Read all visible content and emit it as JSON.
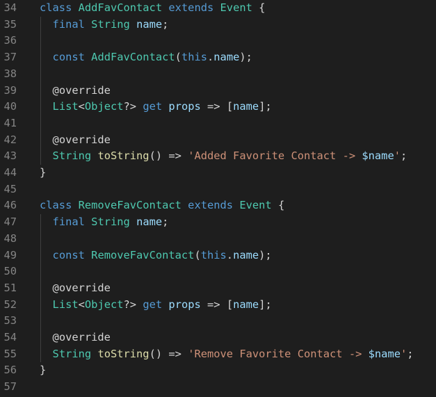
{
  "editor": {
    "colors": {
      "background": "#1e1e1e",
      "line_number": "#858585",
      "keyword": "#569cd6",
      "type": "#4ec9b0",
      "identifier": "#9cdcfe",
      "function": "#dcdcaa",
      "string": "#ce9178",
      "punctuation": "#d4d4d4"
    },
    "lines": [
      {
        "num": "34",
        "tokens": [
          {
            "t": "class",
            "c": "kw"
          },
          {
            "t": " ",
            "c": "pu"
          },
          {
            "t": "AddFavContact",
            "c": "ty"
          },
          {
            "t": " ",
            "c": "pu"
          },
          {
            "t": "extends",
            "c": "kw"
          },
          {
            "t": " ",
            "c": "pu"
          },
          {
            "t": "Event",
            "c": "ty"
          },
          {
            "t": " {",
            "c": "pu"
          }
        ]
      },
      {
        "num": "35",
        "tokens": [
          {
            "t": "  ",
            "c": "pu"
          },
          {
            "t": "final",
            "c": "kw"
          },
          {
            "t": " ",
            "c": "pu"
          },
          {
            "t": "String",
            "c": "ty"
          },
          {
            "t": " ",
            "c": "pu"
          },
          {
            "t": "name",
            "c": "id"
          },
          {
            "t": ";",
            "c": "pu"
          }
        ]
      },
      {
        "num": "36",
        "tokens": []
      },
      {
        "num": "37",
        "tokens": [
          {
            "t": "  ",
            "c": "pu"
          },
          {
            "t": "const",
            "c": "kw"
          },
          {
            "t": " ",
            "c": "pu"
          },
          {
            "t": "AddFavContact",
            "c": "ty"
          },
          {
            "t": "(",
            "c": "pu"
          },
          {
            "t": "this",
            "c": "kw"
          },
          {
            "t": ".",
            "c": "pu"
          },
          {
            "t": "name",
            "c": "id"
          },
          {
            "t": ");",
            "c": "pu"
          }
        ]
      },
      {
        "num": "38",
        "tokens": []
      },
      {
        "num": "39",
        "tokens": [
          {
            "t": "  ",
            "c": "pu"
          },
          {
            "t": "@override",
            "c": "an"
          }
        ]
      },
      {
        "num": "40",
        "tokens": [
          {
            "t": "  ",
            "c": "pu"
          },
          {
            "t": "List",
            "c": "ty"
          },
          {
            "t": "<",
            "c": "pu"
          },
          {
            "t": "Object",
            "c": "ty"
          },
          {
            "t": "?> ",
            "c": "pu"
          },
          {
            "t": "get",
            "c": "kw"
          },
          {
            "t": " ",
            "c": "pu"
          },
          {
            "t": "props",
            "c": "id"
          },
          {
            "t": " => [",
            "c": "pu"
          },
          {
            "t": "name",
            "c": "id"
          },
          {
            "t": "];",
            "c": "pu"
          }
        ]
      },
      {
        "num": "41",
        "tokens": []
      },
      {
        "num": "42",
        "tokens": [
          {
            "t": "  ",
            "c": "pu"
          },
          {
            "t": "@override",
            "c": "an"
          }
        ]
      },
      {
        "num": "43",
        "tokens": [
          {
            "t": "  ",
            "c": "pu"
          },
          {
            "t": "String",
            "c": "ty"
          },
          {
            "t": " ",
            "c": "pu"
          },
          {
            "t": "toString",
            "c": "fn"
          },
          {
            "t": "() => ",
            "c": "pu"
          },
          {
            "t": "'Added Favorite Contact -> ",
            "c": "st"
          },
          {
            "t": "$name",
            "c": "id"
          },
          {
            "t": "'",
            "c": "st"
          },
          {
            "t": ";",
            "c": "pu"
          }
        ]
      },
      {
        "num": "44",
        "tokens": [
          {
            "t": "}",
            "c": "pu"
          }
        ]
      },
      {
        "num": "45",
        "tokens": []
      },
      {
        "num": "46",
        "tokens": [
          {
            "t": "class",
            "c": "kw"
          },
          {
            "t": " ",
            "c": "pu"
          },
          {
            "t": "RemoveFavContact",
            "c": "ty"
          },
          {
            "t": " ",
            "c": "pu"
          },
          {
            "t": "extends",
            "c": "kw"
          },
          {
            "t": " ",
            "c": "pu"
          },
          {
            "t": "Event",
            "c": "ty"
          },
          {
            "t": " {",
            "c": "pu"
          }
        ]
      },
      {
        "num": "47",
        "tokens": [
          {
            "t": "  ",
            "c": "pu"
          },
          {
            "t": "final",
            "c": "kw"
          },
          {
            "t": " ",
            "c": "pu"
          },
          {
            "t": "String",
            "c": "ty"
          },
          {
            "t": " ",
            "c": "pu"
          },
          {
            "t": "name",
            "c": "id"
          },
          {
            "t": ";",
            "c": "pu"
          }
        ]
      },
      {
        "num": "48",
        "tokens": []
      },
      {
        "num": "49",
        "tokens": [
          {
            "t": "  ",
            "c": "pu"
          },
          {
            "t": "const",
            "c": "kw"
          },
          {
            "t": " ",
            "c": "pu"
          },
          {
            "t": "RemoveFavContact",
            "c": "ty"
          },
          {
            "t": "(",
            "c": "pu"
          },
          {
            "t": "this",
            "c": "kw"
          },
          {
            "t": ".",
            "c": "pu"
          },
          {
            "t": "name",
            "c": "id"
          },
          {
            "t": ");",
            "c": "pu"
          }
        ]
      },
      {
        "num": "50",
        "tokens": []
      },
      {
        "num": "51",
        "tokens": [
          {
            "t": "  ",
            "c": "pu"
          },
          {
            "t": "@override",
            "c": "an"
          }
        ]
      },
      {
        "num": "52",
        "tokens": [
          {
            "t": "  ",
            "c": "pu"
          },
          {
            "t": "List",
            "c": "ty"
          },
          {
            "t": "<",
            "c": "pu"
          },
          {
            "t": "Object",
            "c": "ty"
          },
          {
            "t": "?> ",
            "c": "pu"
          },
          {
            "t": "get",
            "c": "kw"
          },
          {
            "t": " ",
            "c": "pu"
          },
          {
            "t": "props",
            "c": "id"
          },
          {
            "t": " => [",
            "c": "pu"
          },
          {
            "t": "name",
            "c": "id"
          },
          {
            "t": "];",
            "c": "pu"
          }
        ]
      },
      {
        "num": "53",
        "tokens": []
      },
      {
        "num": "54",
        "tokens": [
          {
            "t": "  ",
            "c": "pu"
          },
          {
            "t": "@override",
            "c": "an"
          }
        ]
      },
      {
        "num": "55",
        "tokens": [
          {
            "t": "  ",
            "c": "pu"
          },
          {
            "t": "String",
            "c": "ty"
          },
          {
            "t": " ",
            "c": "pu"
          },
          {
            "t": "toString",
            "c": "fn"
          },
          {
            "t": "() => ",
            "c": "pu"
          },
          {
            "t": "'Remove Favorite Contact -> ",
            "c": "st"
          },
          {
            "t": "$name",
            "c": "id"
          },
          {
            "t": "'",
            "c": "st"
          },
          {
            "t": ";",
            "c": "pu"
          }
        ]
      },
      {
        "num": "56",
        "tokens": [
          {
            "t": "}",
            "c": "pu"
          }
        ]
      },
      {
        "num": "57",
        "tokens": []
      }
    ]
  }
}
